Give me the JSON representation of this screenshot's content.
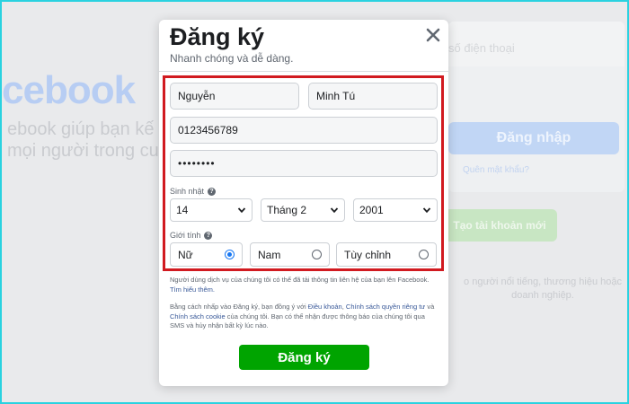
{
  "background": {
    "logo": "cebook",
    "tagline_line1": "ebook giúp bạn kế",
    "tagline_line2": "mọi người trong cu",
    "phone_placeholder": "số điện thoại",
    "login_button": "Đăng nhập",
    "forgot_link": "Quên mật khẩu?",
    "create_button": "Tạo tài khoản mới",
    "promo_text": "o người nổi tiếng, thương hiệu hoặc doanh nghiệp."
  },
  "modal": {
    "title": "Đăng ký",
    "subtitle": "Nhanh chóng và dễ dàng.",
    "close_icon": "close-icon"
  },
  "form": {
    "first_name": "Nguyễn",
    "last_name": "Minh Tú",
    "contact": "0123456789",
    "password": "••••••••",
    "birthday_label": "Sinh nhật",
    "birthday": {
      "day": "14",
      "month": "Tháng 2",
      "year": "2001"
    },
    "gender_label": "Giới tính",
    "gender_options": [
      "Nữ",
      "Nam",
      "Tùy chỉnh"
    ],
    "gender_selected": "Nữ",
    "help_glyph": "?"
  },
  "legal": {
    "p1_text": "Người dùng dịch vụ của chúng tôi có thể đã tải thông tin liên hệ của bạn lên Facebook. ",
    "p1_link": "Tìm hiểu thêm.",
    "p2_a": "Bằng cách nhấp vào Đăng ký, bạn đồng ý với ",
    "p2_terms": "Điều khoản",
    "p2_b": ", ",
    "p2_privacy": "Chính sách quyền riêng tư",
    "p2_c": " và ",
    "p2_cookie": "Chính sách cookie",
    "p2_d": " của chúng tôi. Bạn có thể nhận được thông báo của chúng tôi qua SMS và hủy nhận bất kỳ lúc nào."
  },
  "submit_label": "Đăng ký",
  "colors": {
    "frame": "#2ad2e0",
    "highlight": "#d11a20",
    "submit": "#00a400",
    "link": "#385898",
    "radio_selected": "#1877f2"
  }
}
